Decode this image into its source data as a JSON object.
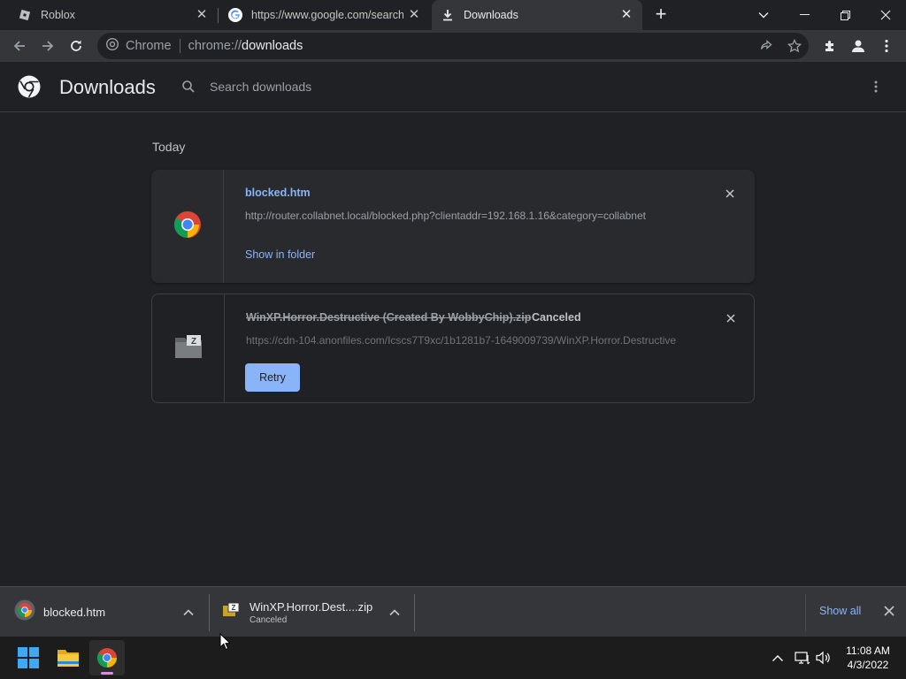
{
  "tabs": [
    {
      "title": "Roblox",
      "icon": "roblox-icon"
    },
    {
      "title": "https://www.google.com/search?",
      "icon": "google-icon"
    },
    {
      "title": "Downloads",
      "icon": "download-icon",
      "active": true
    }
  ],
  "omnibox": {
    "chip": "Chrome",
    "scheme": "chrome://",
    "host": "downloads"
  },
  "page": {
    "title": "Downloads",
    "search_placeholder": "Search downloads"
  },
  "list": {
    "date_header": "Today",
    "items": [
      {
        "filename": "blocked.htm",
        "url": "http://router.collabnet.local/blocked.php?clientaddr=192.168.1.16&category=collabnet",
        "action": "Show in folder",
        "icon": "chrome-icon"
      },
      {
        "filename": "WinXP.Horror.Destructive (Created By WobbyChip).zip",
        "status": "Canceled",
        "url": "https://cdn-104.anonfiles.com/Icscs7T9xc/1b1281b7-1649009739/WinXP.Horror.Destructive",
        "action": "Retry",
        "icon": "zip-file-icon"
      }
    ]
  },
  "shelf": {
    "items": [
      {
        "name": "blocked.htm",
        "status": ""
      },
      {
        "name": "WinXP.Horror.Dest....zip",
        "status": "Canceled"
      }
    ],
    "show_all": "Show all"
  },
  "taskbar": {
    "time": "11:08 AM",
    "date": "4/3/2022"
  },
  "colors": {
    "accent": "#8ab4f8",
    "background": "#202124",
    "toolbar": "#35363a"
  }
}
